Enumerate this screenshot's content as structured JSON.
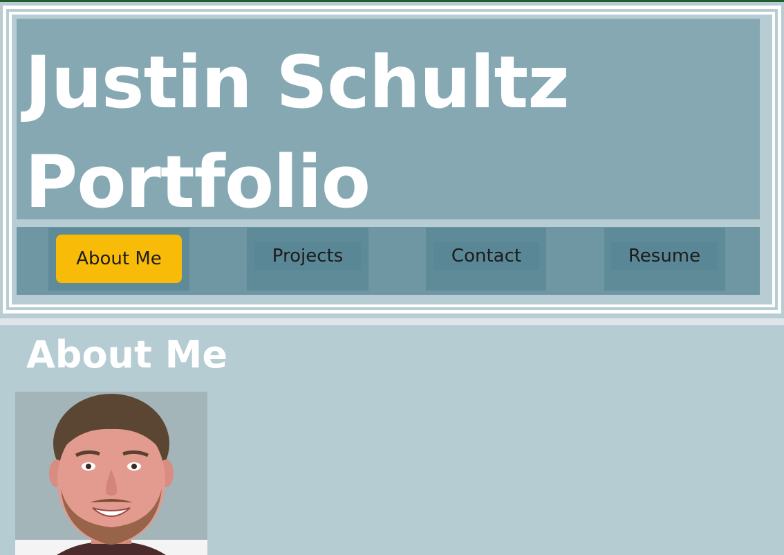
{
  "header": {
    "title_line1": "Justin Schultz",
    "title_line2": "Portfolio"
  },
  "nav": {
    "items": [
      {
        "label": "About Me",
        "active": true
      },
      {
        "label": "Projects",
        "active": false
      },
      {
        "label": "Contact",
        "active": false
      },
      {
        "label": "Resume",
        "active": false
      }
    ]
  },
  "main": {
    "section_title": "About Me",
    "profile_photo": "profile-photo"
  },
  "colors": {
    "header_bg": "#85a8b3",
    "nav_bg": "#6e96a3",
    "active_button": "#f7bb08",
    "content_bg": "#b6ccd3",
    "title_text": "#ffffff"
  }
}
